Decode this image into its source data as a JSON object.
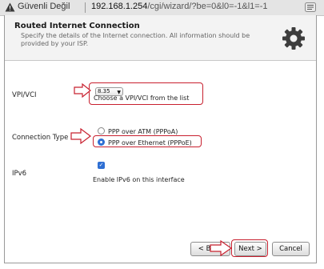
{
  "addressbar": {
    "security_label": "Güvenli Değil",
    "url_host": "192.168.1.254",
    "url_path": "/cgi/wizard/?be=0&l0=-1&l1=-1",
    "warning_icon": "warning-triangle-icon",
    "reader_icon": "reader-icon"
  },
  "header": {
    "title": "Routed Internet Connection",
    "subtitle": "Specify the details of the Internet connection. All information should be provided by your ISP.",
    "icon": "gear-icon"
  },
  "form": {
    "vpi_label": "VPI/VCI",
    "vpi_value": "8.35",
    "vpi_help": "Choose a VPI/VCI from the list",
    "conn_label": "Connection Type",
    "conn_options": [
      {
        "label": "PPP over ATM (PPPoA)",
        "selected": false
      },
      {
        "label": "PPP over Ethernet (PPPoE)",
        "selected": true
      }
    ],
    "ipv6_label": "IPv6",
    "ipv6_checked": true,
    "ipv6_text": "Enable IPv6 on this interface"
  },
  "buttons": {
    "back": "< Back",
    "next": "Next >",
    "cancel": "Cancel"
  },
  "colors": {
    "highlight": "#c8202f",
    "accent": "#2f6fd3"
  }
}
